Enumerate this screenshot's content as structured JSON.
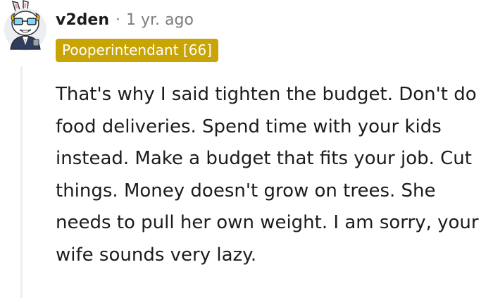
{
  "comment": {
    "author": "v2den",
    "separator": "·",
    "timestamp": "1 yr. ago",
    "flair": "Pooperintendant [66]",
    "avatar_icon": "bunny-mascot-avatar-icon",
    "text": "That's why I said tighten the budget. Don't do food deliveries. Spend time with your kids instead. Make a budget that fits your job. Cut things. Money doesn't grow on trees. She needs to pull her own weight. I am sorry, your wife sounds very lazy."
  },
  "colors": {
    "flair_background": "#c9a405",
    "flair_text": "#ffffff",
    "username": "#1c1c1c",
    "meta": "#7c7c7c",
    "thread_line": "#edeff1"
  }
}
